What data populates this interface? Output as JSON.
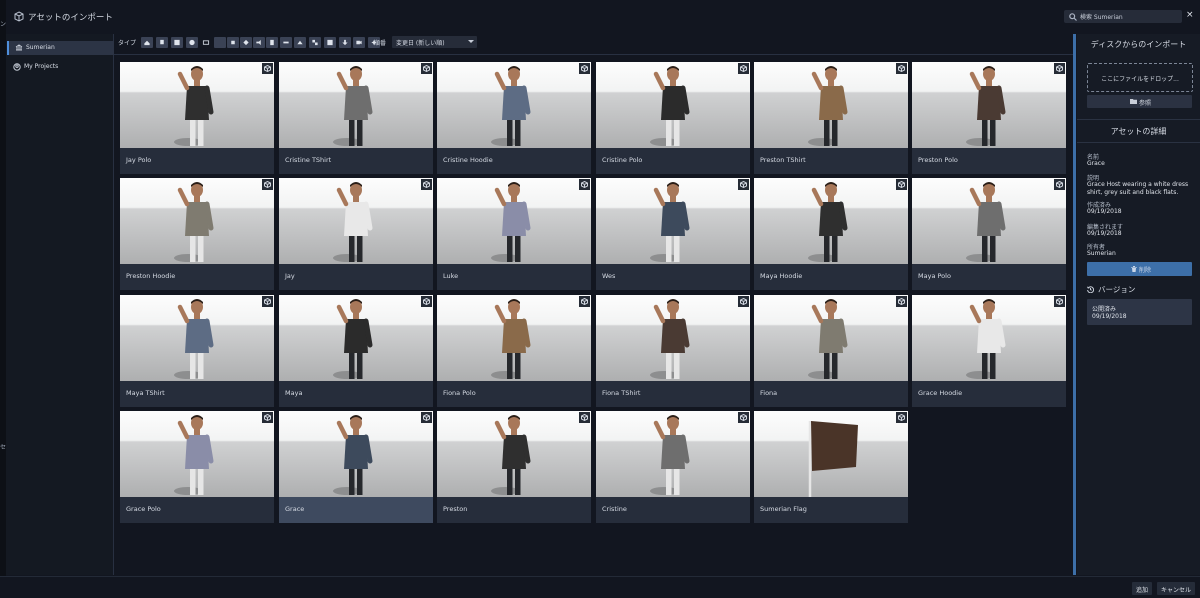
{
  "window": {
    "title": "アセットのインポート",
    "search_placeholder": "検索 Sumerian",
    "close_label": "×",
    "edge_glyphs": [
      "ン",
      "セ"
    ]
  },
  "sidebar": {
    "items": [
      {
        "label": "Sumerian",
        "icon": "library-icon",
        "active": true
      },
      {
        "label": "My Projects",
        "icon": "projects-icon",
        "active": false
      }
    ]
  },
  "toolbar": {
    "type_label": "タイプ",
    "type_filters": [
      "entity",
      "mesh",
      "material",
      "shader",
      "sphere",
      "skeleton",
      "animation",
      "behavior",
      "script",
      "audio",
      "texture",
      "box",
      "environment",
      "sky",
      "light",
      "camera",
      "fx"
    ],
    "sort_label": "順番",
    "sort_value": "変更日 (新しい順)"
  },
  "assets": [
    {
      "label": "Jay Polo",
      "selected": false
    },
    {
      "label": "Cristine TShirt",
      "selected": false
    },
    {
      "label": "Cristine Hoodie",
      "selected": false
    },
    {
      "label": "Cristine Polo",
      "selected": false
    },
    {
      "label": "Preston TShirt",
      "selected": false
    },
    {
      "label": "Preston Polo",
      "selected": false
    },
    {
      "label": "Preston Hoodie",
      "selected": false
    },
    {
      "label": "Jay",
      "selected": false
    },
    {
      "label": "Luke",
      "selected": false
    },
    {
      "label": "Wes",
      "selected": false
    },
    {
      "label": "Maya Hoodie",
      "selected": false
    },
    {
      "label": "Maya Polo",
      "selected": false
    },
    {
      "label": "Maya TShirt",
      "selected": false
    },
    {
      "label": "Maya",
      "selected": false
    },
    {
      "label": "Fiona Polo",
      "selected": false
    },
    {
      "label": "Fiona TShirt",
      "selected": false
    },
    {
      "label": "Fiona",
      "selected": false
    },
    {
      "label": "Grace Hoodie",
      "selected": false
    },
    {
      "label": "Grace Polo",
      "selected": false
    },
    {
      "label": "Grace",
      "selected": true
    },
    {
      "label": "Preston",
      "selected": false
    },
    {
      "label": "Cristine",
      "selected": false
    },
    {
      "label": "Sumerian Flag",
      "selected": false
    }
  ],
  "colors": {
    "accent": "#3d6fa8",
    "background": "#121620",
    "card": "#262d3b",
    "card_selected": "#3e4a5f"
  },
  "right_panel": {
    "import_title": "ディスクからのインポート",
    "drop_text": "ここにファイルをドロップ...",
    "browse_label": "参照",
    "details_title": "アセットの詳細",
    "name_label": "名前",
    "name_value": "Grace",
    "desc_label": "説明",
    "desc_line1": "Grace Host wearing a white dress",
    "desc_line2": "shirt, grey suit and black flats.",
    "created_label": "作成済み",
    "created_value": "09/19/2018",
    "edited_label": "編集されます",
    "edited_value": "09/19/2018",
    "owner_label": "所有者",
    "owner_value": "Sumerian",
    "delete_label": "削除",
    "version_title": "バージョン",
    "version_status": "公開済み",
    "version_date": "09/19/2018"
  },
  "footer": {
    "add_label": "追加",
    "cancel_label": "キャンセル"
  }
}
